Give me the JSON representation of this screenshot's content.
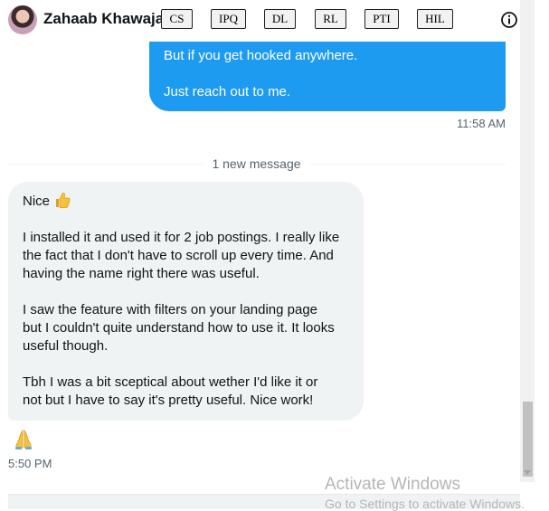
{
  "header": {
    "contact_name": "Zahaab Khawaja",
    "tags": [
      "CS",
      "IPQ",
      "DL",
      "RL",
      "PTI",
      "HIL"
    ],
    "info_icon": "info-icon"
  },
  "outgoing": {
    "line1": "But if you get hooked anywhere.",
    "line2": "Just reach out to me.",
    "time": "11:58 AM"
  },
  "divider": {
    "label": "1 new message"
  },
  "incoming": {
    "greeting": "Nice",
    "greeting_emoji": "thumbs-up-icon",
    "lines": [
      "I installed it and used it for 2 job postings. I really like",
      "the fact that I don't have to scroll up every time. And",
      "having the name right there was useful.",
      "I saw the feature with filters on your landing page",
      "but I couldn't quite understand how to use it. It looks",
      "useful though.",
      "Tbh I was a bit sceptical about wether I'd like it or",
      "not but I have to say it's pretty useful. Nice work!"
    ],
    "reaction": "folded-hands-icon",
    "time": "5:50 PM"
  },
  "watermark": {
    "line1": "Activate Windows",
    "line2": "Go to Settings to activate Windows."
  },
  "colors": {
    "accent": "#1d9bf0",
    "bubble_in": "#eff3f4",
    "secondary_text": "#536471"
  }
}
